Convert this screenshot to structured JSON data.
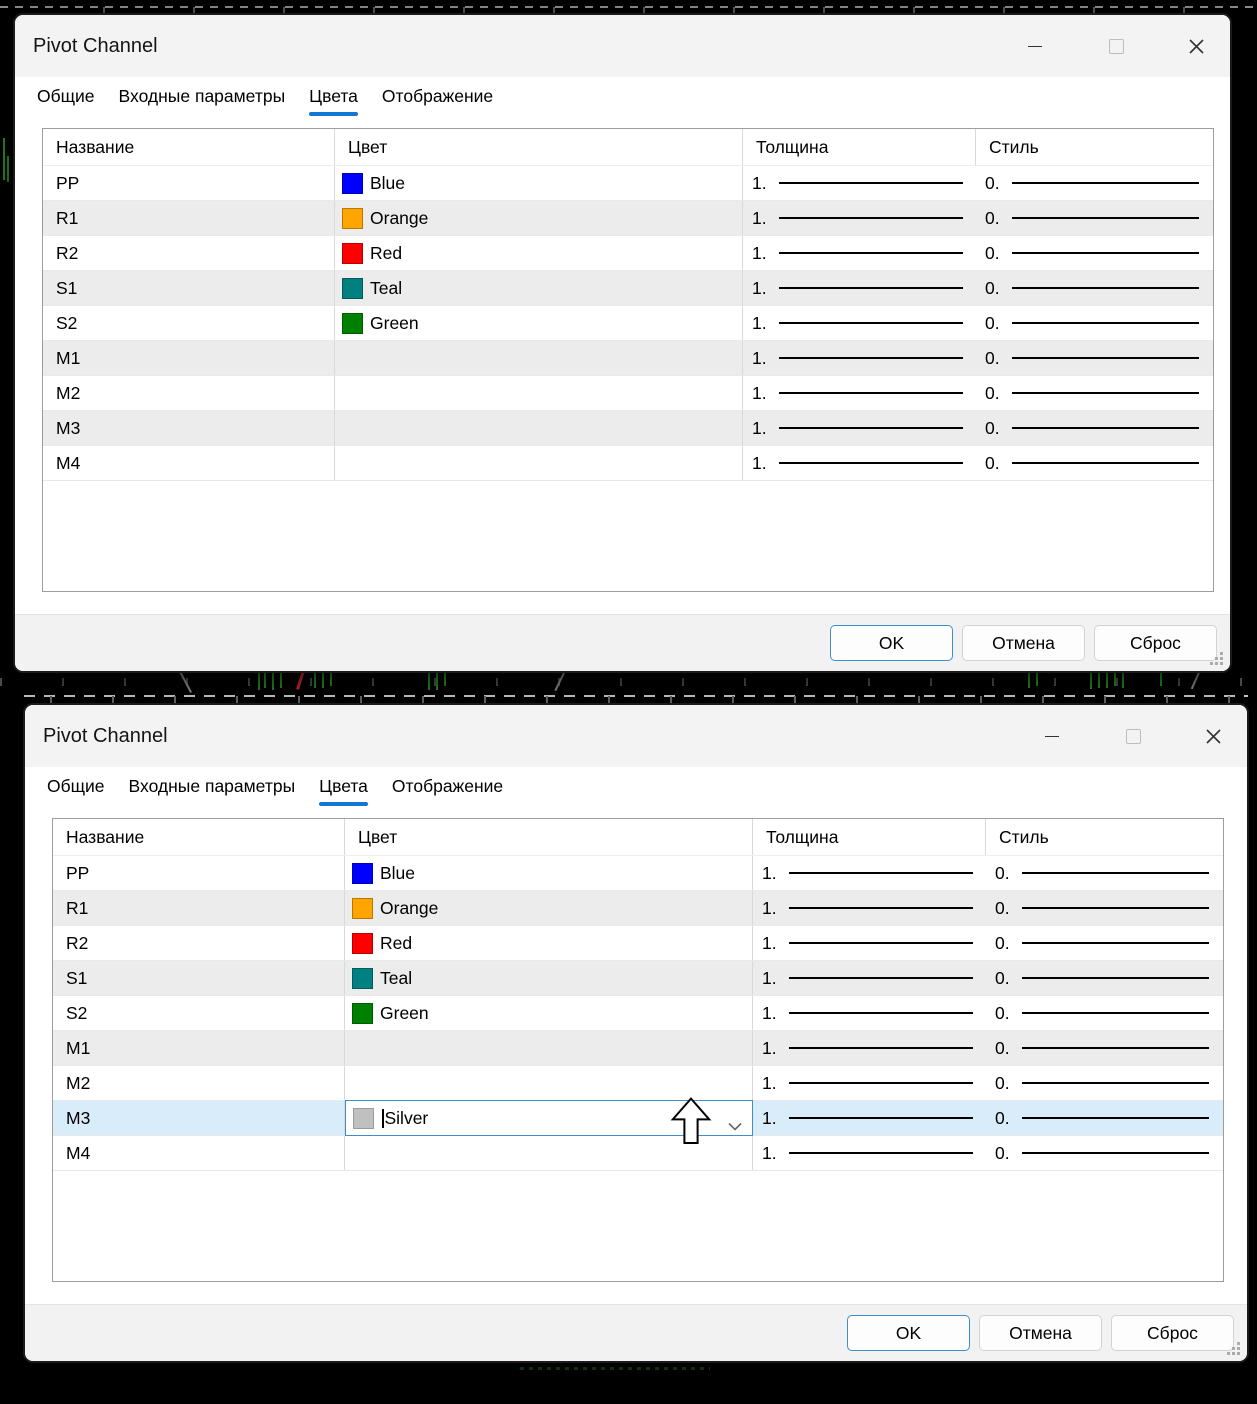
{
  "palette": {
    "accent_blue": "#1377d2",
    "selection_bg": "#d9ecfa",
    "stripe_bg": "#ececec",
    "titlebar_bg": "#f3f3f3"
  },
  "window": {
    "title": "Pivot Channel",
    "tabs": [
      {
        "label": "Общие",
        "active": false
      },
      {
        "label": "Входные параметры",
        "active": false
      },
      {
        "label": "Цвета",
        "active": true
      },
      {
        "label": "Отображение",
        "active": false
      }
    ],
    "table": {
      "columns": [
        "Название",
        "Цвет",
        "Толщина",
        "Стиль"
      ],
      "rows": [
        {
          "name": "PP",
          "color": {
            "label": "Blue",
            "hex": "#0000ff"
          },
          "thickness": "1.",
          "style": "0."
        },
        {
          "name": "R1",
          "color": {
            "label": "Orange",
            "hex": "#ffa500"
          },
          "thickness": "1.",
          "style": "0."
        },
        {
          "name": "R2",
          "color": {
            "label": "Red",
            "hex": "#ff0000"
          },
          "thickness": "1.",
          "style": "0."
        },
        {
          "name": "S1",
          "color": {
            "label": "Teal",
            "hex": "#008080"
          },
          "thickness": "1.",
          "style": "0."
        },
        {
          "name": "S2",
          "color": {
            "label": "Green",
            "hex": "#008000"
          },
          "thickness": "1.",
          "style": "0."
        },
        {
          "name": "M1",
          "color": null,
          "thickness": "1.",
          "style": "0."
        },
        {
          "name": "M2",
          "color": null,
          "thickness": "1.",
          "style": "0."
        },
        {
          "name": "M3",
          "color": null,
          "thickness": "1.",
          "style": "0."
        },
        {
          "name": "M4",
          "color": null,
          "thickness": "1.",
          "style": "0."
        }
      ]
    },
    "buttons": {
      "ok": "OK",
      "cancel": "Отмена",
      "reset": "Сброс"
    }
  },
  "second_window_state": {
    "selected_row": "M3",
    "color_editor": {
      "value": "Silver",
      "swatch_hex": "#c0c0c0"
    }
  }
}
